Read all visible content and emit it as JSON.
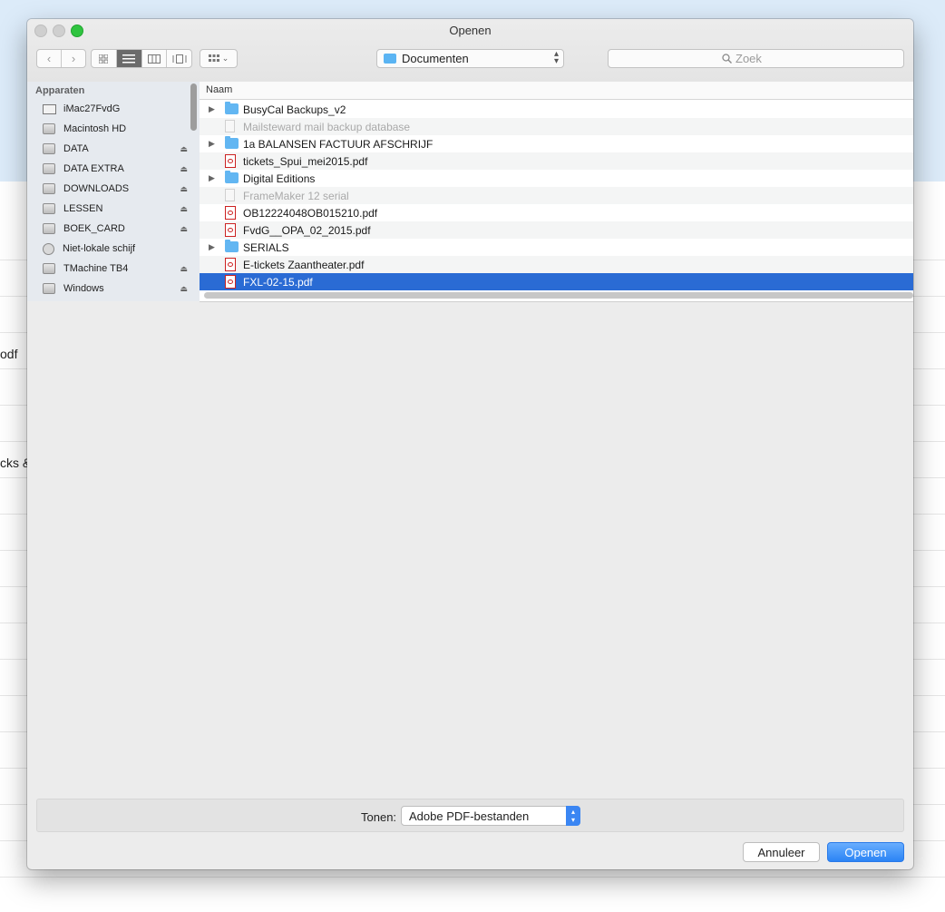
{
  "window": {
    "title": "Openen"
  },
  "toolbar": {
    "back_icon": "chevron-left-icon",
    "forward_icon": "chevron-right-icon",
    "views": [
      "icon-view",
      "list-view",
      "column-view",
      "coverflow-view"
    ],
    "active_view": "list-view",
    "location": "Documenten",
    "search_placeholder": "Zoek"
  },
  "sidebar": {
    "heading": "Apparaten",
    "items": [
      {
        "label": "iMac27FvdG",
        "icon": "monitor-icon",
        "eject": false
      },
      {
        "label": "Macintosh HD",
        "icon": "disk-icon",
        "eject": false
      },
      {
        "label": "DATA",
        "icon": "disk-icon",
        "eject": true
      },
      {
        "label": "DATA EXTRA",
        "icon": "disk-icon",
        "eject": true
      },
      {
        "label": "DOWNLOADS",
        "icon": "disk-icon",
        "eject": true
      },
      {
        "label": "LESSEN",
        "icon": "disk-icon",
        "eject": true
      },
      {
        "label": "BOEK_CARD",
        "icon": "disk-icon",
        "eject": true
      },
      {
        "label": "Niet-lokale schijf",
        "icon": "network-disc-icon",
        "eject": false
      },
      {
        "label": "TMachine TB4",
        "icon": "disk-icon",
        "eject": true
      },
      {
        "label": "Windows",
        "icon": "disk-icon",
        "eject": true
      }
    ]
  },
  "file_list": {
    "column_header": "Naam",
    "rows": [
      {
        "name": "BusyCal Backups_v2",
        "type": "folder",
        "expandable": true,
        "dimmed": false,
        "selected": false
      },
      {
        "name": "Mailsteward mail backup database",
        "type": "document",
        "expandable": false,
        "dimmed": true,
        "selected": false
      },
      {
        "name": "1a  BALANSEN FACTUUR AFSCHRIJF",
        "type": "folder",
        "expandable": true,
        "dimmed": false,
        "selected": false
      },
      {
        "name": "tickets_Spui_mei2015.pdf",
        "type": "pdf",
        "expandable": false,
        "dimmed": false,
        "selected": false
      },
      {
        "name": "Digital Editions",
        "type": "folder",
        "expandable": true,
        "dimmed": false,
        "selected": false
      },
      {
        "name": "FrameMaker 12 serial",
        "type": "document",
        "expandable": false,
        "dimmed": true,
        "selected": false
      },
      {
        "name": "OB12224048OB015210.pdf",
        "type": "pdf",
        "expandable": false,
        "dimmed": false,
        "selected": false
      },
      {
        "name": "FvdG__OPA_02_2015.pdf",
        "type": "pdf",
        "expandable": false,
        "dimmed": false,
        "selected": false
      },
      {
        "name": "SERIALS",
        "type": "folder",
        "expandable": true,
        "dimmed": false,
        "selected": false
      },
      {
        "name": "E-tickets Zaantheater.pdf",
        "type": "pdf",
        "expandable": false,
        "dimmed": false,
        "selected": false
      },
      {
        "name": "FXL-02-15.pdf",
        "type": "pdf",
        "expandable": false,
        "dimmed": false,
        "selected": true
      }
    ]
  },
  "filter": {
    "label": "Tonen:",
    "selected": "Adobe PDF-bestanden"
  },
  "buttons": {
    "cancel": "Annuleer",
    "open": "Openen"
  },
  "background_fragments": [
    "odf",
    "cks &"
  ],
  "colors": {
    "selection": "#2a6bd4",
    "accent": "#2b84f5",
    "folder": "#62b6f2"
  }
}
